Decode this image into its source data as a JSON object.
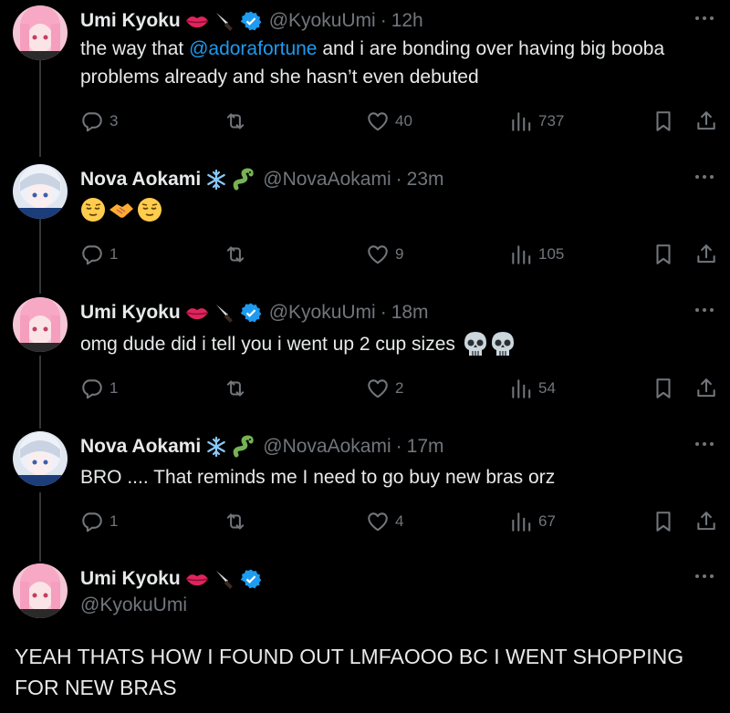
{
  "tweets": [
    {
      "name": "Umi Kyoku",
      "handle": "@KyokuUmi",
      "time": "12h",
      "text_before": "the way that ",
      "mention": "@adorafortune",
      "text_after": " and i are bonding over having big booba problems already and she hasn’t even debuted",
      "replies": "3",
      "retweets": "",
      "likes": "40",
      "views": "737"
    },
    {
      "name": "Nova Aokami",
      "handle": "@NovaAokami",
      "time": "23m",
      "text": "",
      "replies": "1",
      "retweets": "",
      "likes": "9",
      "views": "105"
    },
    {
      "name": "Umi Kyoku",
      "handle": "@KyokuUmi",
      "time": "18m",
      "text": "omg dude did i tell you i went up 2 cup sizes",
      "replies": "1",
      "retweets": "",
      "likes": "2",
      "views": "54"
    },
    {
      "name": "Nova Aokami",
      "handle": "@NovaAokami",
      "time": "17m",
      "text": "BRO .... That reminds me I need to go buy new bras orz",
      "replies": "1",
      "retweets": "",
      "likes": "4",
      "views": "67"
    },
    {
      "name": "Umi Kyoku",
      "handle": "@KyokuUmi",
      "text": "YEAH THATS HOW I FOUND OUT LMFAOOO BC I WENT SHOPPING FOR NEW BRAS"
    }
  ],
  "colors": {
    "background": "#000000",
    "text": "#e7e9ea",
    "muted": "#71767b",
    "accent": "#1d9bf0",
    "thread_line": "#333639"
  },
  "icons": [
    "reply-icon",
    "retweet-icon",
    "like-icon",
    "views-icon",
    "bookmark-icon",
    "share-icon",
    "more-icon",
    "verified-badge-icon"
  ]
}
